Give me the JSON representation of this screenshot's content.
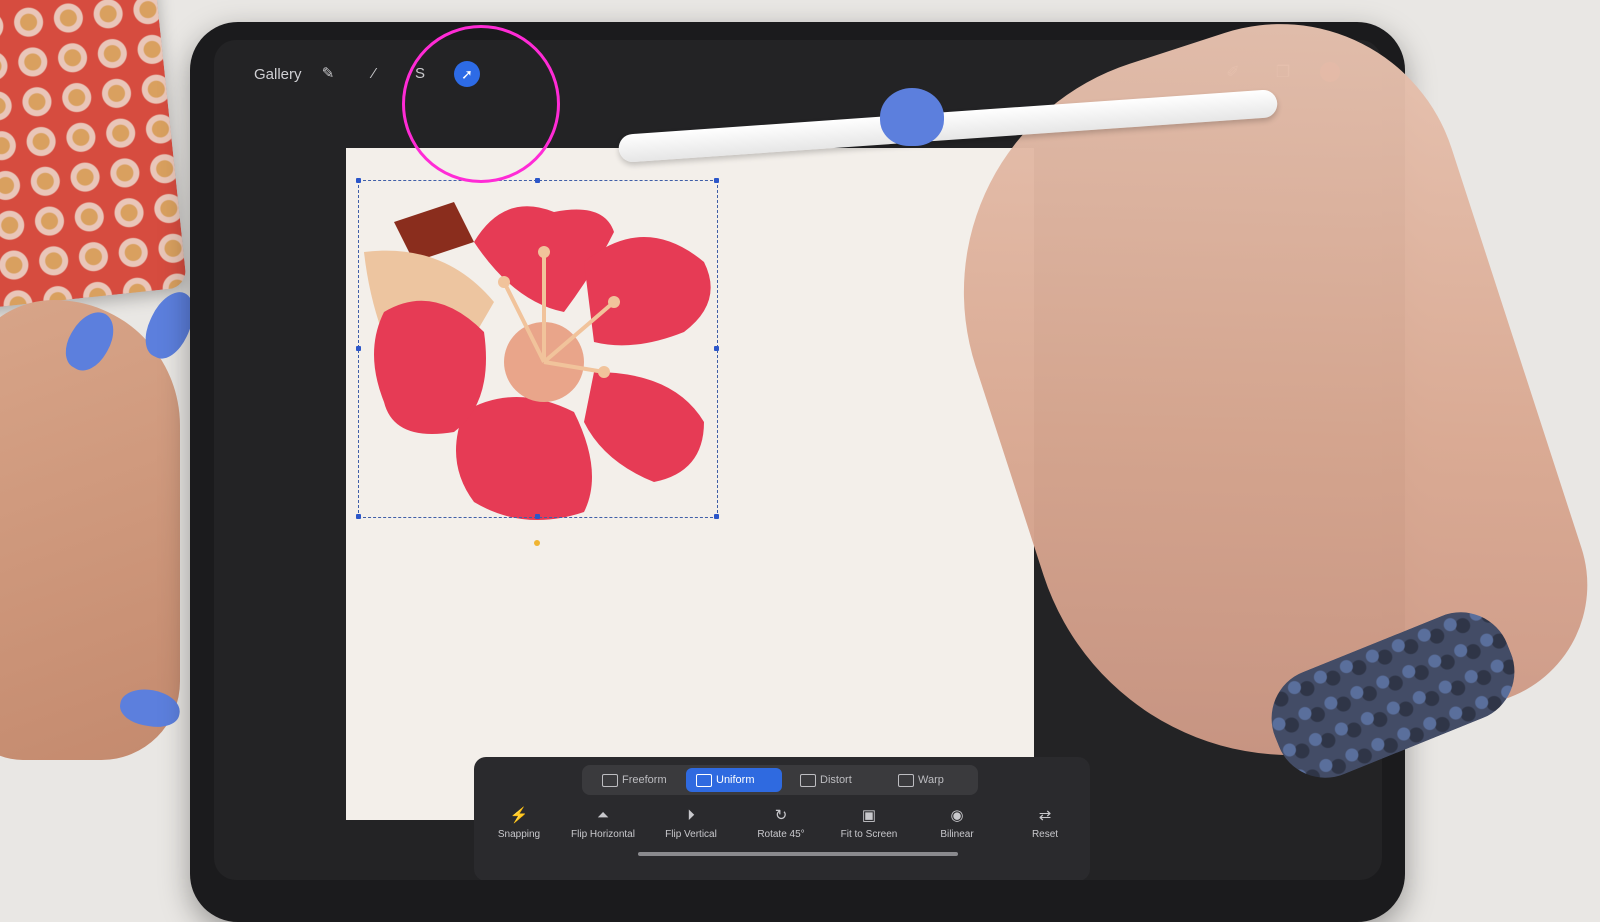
{
  "topbar": {
    "gallery_label": "Gallery",
    "left_icons": [
      "wrench-icon",
      "adjustments-wand-icon",
      "selection-s-icon",
      "transform-arrow-icon"
    ],
    "active_tool": "transform-arrow-icon",
    "right_icons": [
      "brush-icon",
      "layers-icon",
      "color-icon"
    ],
    "color_current": "#c3352b"
  },
  "transform": {
    "modes": [
      {
        "label": "Freeform",
        "active": false
      },
      {
        "label": "Uniform",
        "active": true
      },
      {
        "label": "Distort",
        "active": false
      },
      {
        "label": "Warp",
        "active": false
      }
    ],
    "tools": [
      {
        "label": "Snapping",
        "icon": "snapping-icon"
      },
      {
        "label": "Flip Horizontal",
        "icon": "flip-horizontal-icon"
      },
      {
        "label": "Flip Vertical",
        "icon": "flip-vertical-icon"
      },
      {
        "label": "Rotate 45°",
        "icon": "rotate-icon"
      },
      {
        "label": "Fit to Screen",
        "icon": "fit-screen-icon"
      },
      {
        "label": "Bilinear",
        "icon": "bilinear-icon"
      },
      {
        "label": "Reset",
        "icon": "reset-icon"
      }
    ]
  },
  "annotation": {
    "highlight_color": "#ff2bd6"
  },
  "colors": {
    "accent": "#2f6ae0",
    "flower": "#e63b55",
    "canvas": "#f3efea"
  }
}
